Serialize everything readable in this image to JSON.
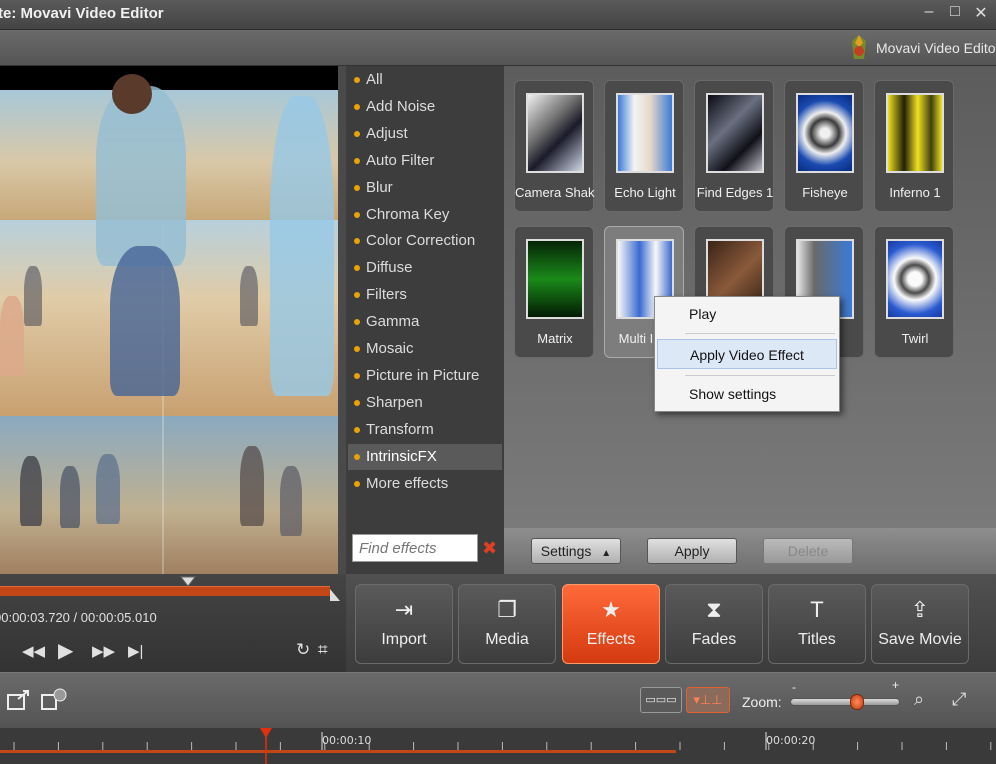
{
  "window": {
    "title": "te: Movavi Video Editor",
    "controls": [
      "–",
      "□",
      "✕"
    ]
  },
  "brand": {
    "text": "Movavi Video Editor"
  },
  "categories": [
    {
      "label": "All"
    },
    {
      "label": "Add Noise"
    },
    {
      "label": "Adjust"
    },
    {
      "label": "Auto Filter"
    },
    {
      "label": "Blur"
    },
    {
      "label": "Chroma Key"
    },
    {
      "label": "Color Correction"
    },
    {
      "label": "Diffuse"
    },
    {
      "label": "Filters"
    },
    {
      "label": "Gamma"
    },
    {
      "label": "Mosaic"
    },
    {
      "label": "Picture in Picture"
    },
    {
      "label": "Sharpen"
    },
    {
      "label": "Transform"
    },
    {
      "label": "IntrinsicFX",
      "selected": true
    },
    {
      "label": "More effects"
    }
  ],
  "search": {
    "placeholder": "Find effects",
    "clear_icon": "close-icon"
  },
  "effects": [
    {
      "label": "Camera Shake"
    },
    {
      "label": "Echo Light"
    },
    {
      "label": "Find Edges 1"
    },
    {
      "label": "Fisheye"
    },
    {
      "label": "Inferno 1"
    },
    {
      "label": "Matrix"
    },
    {
      "label": "Multi Ima"
    },
    {
      "label": ""
    },
    {
      "label": ""
    },
    {
      "label": "Twirl"
    }
  ],
  "context_menu": {
    "items": [
      "Play",
      "Apply Video Effect",
      "Show settings"
    ],
    "highlighted": "Apply Video Effect"
  },
  "effect_actions": {
    "settings": "Settings",
    "settings_arrow": "▲",
    "apply": "Apply",
    "delete": "Delete"
  },
  "transport": {
    "current_time": "00:00:03.720",
    "separator": "/",
    "total_time": "00:00:05.010",
    "position": 0.74
  },
  "nav": {
    "buttons": [
      {
        "label": "Import",
        "icon": "import-icon",
        "glyph": "⇥"
      },
      {
        "label": "Media",
        "icon": "media-icon",
        "glyph": "❐"
      },
      {
        "label": "Effects",
        "icon": "star-icon",
        "glyph": "★",
        "active": true
      },
      {
        "label": "Fades",
        "icon": "fades-icon",
        "glyph": "⧗"
      },
      {
        "label": "Titles",
        "icon": "titles-icon",
        "glyph": "T"
      },
      {
        "label": "Save Movie",
        "icon": "save-movie-icon",
        "glyph": "⇪"
      }
    ]
  },
  "timeline": {
    "zoom_label": "Zoom:",
    "zoom_minus": "-",
    "zoom_plus": "+",
    "zoom_level": 0.6,
    "ruler_labels": [
      "00:00:10",
      "00:00:20"
    ]
  },
  "colors": {
    "accent": "#e0501e",
    "category_dot": "#e8a20a",
    "context_highlight": "#dde8f6"
  }
}
